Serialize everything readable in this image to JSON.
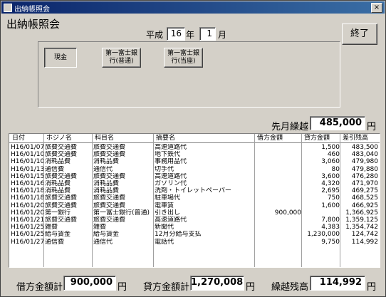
{
  "window": {
    "title": "出納帳照会",
    "close_glyph": "×"
  },
  "heading": "出納帳照会",
  "period": {
    "era": "平成",
    "year": "16",
    "year_unit": "年",
    "month": "1",
    "month_unit": "月"
  },
  "exit_button": "終了",
  "accounts": [
    {
      "label": "現金",
      "selected": true
    },
    {
      "label": "第一富士銀\n行(普通)",
      "selected": false
    },
    {
      "label": "第一富士銀\n行(当座)",
      "selected": false
    }
  ],
  "carry_over": {
    "label": "先月繰越",
    "value": "485,000",
    "unit": "円"
  },
  "table": {
    "headers": [
      "日付",
      "ホジノ名",
      "科目名",
      "摘要名",
      "借方金額",
      "貸方金額",
      "差引残高"
    ],
    "rows": [
      [
        "H16/01/07",
        "旅費交通費",
        "旅費交通費",
        "高速道路代",
        "",
        "1,500",
        "483,500"
      ],
      [
        "H16/01/10",
        "旅費交通費",
        "旅費交通費",
        "地下鉄代",
        "",
        "460",
        "483,040"
      ],
      [
        "H16/01/10",
        "消耗品費",
        "消耗品費",
        "事務用品代",
        "",
        "3,060",
        "479,980"
      ],
      [
        "H16/01/13",
        "通信費",
        "通信代",
        "切手代",
        "",
        "80",
        "479,880"
      ],
      [
        "H16/01/15",
        "旅費交通費",
        "旅費交通費",
        "高速道路代",
        "",
        "3,600",
        "476,280"
      ],
      [
        "H16/01/16",
        "消耗品費",
        "消耗品費",
        "ガソリン代",
        "",
        "4,320",
        "471,970"
      ],
      [
        "H16/01/18",
        "消耗品費",
        "消耗品費",
        "洗剤・トイレットペーパー",
        "",
        "2,695",
        "469,275"
      ],
      [
        "H16/01/18",
        "旅費交通費",
        "旅費交通費",
        "駐車場代",
        "",
        "750",
        "468,525"
      ],
      [
        "H16/01/20",
        "旅費交通費",
        "旅費交通費",
        "電車賃",
        "",
        "1,600",
        "466,925"
      ],
      [
        "H16/01/20",
        "第一銀行",
        "第一富士銀行(普通)",
        "引き出し",
        "900,000",
        "",
        "1,366,925"
      ],
      [
        "H16/01/21",
        "旅費交通費",
        "旅費交通費",
        "高速道路代",
        "",
        "7,800",
        "1,359,125"
      ],
      [
        "H16/01/25",
        "雑費",
        "雑費",
        "新聞代",
        "",
        "4,383",
        "1,354,742"
      ],
      [
        "H16/01/25",
        "給与賃金",
        "給与賃金",
        "12月分給与支払",
        "",
        "1,230,000",
        "124,742"
      ],
      [
        "H16/01/27",
        "通信費",
        "通信代",
        "電話代",
        "",
        "9,750",
        "114,992"
      ]
    ]
  },
  "totals": {
    "debit_label": "借方金額計",
    "debit_value": "900,000",
    "debit_unit": "円",
    "credit_label": "貸方金額計",
    "credit_value": "1,270,008",
    "credit_unit": "円",
    "balance_label": "繰越残高",
    "balance_value": "114,992",
    "balance_unit": "円"
  }
}
